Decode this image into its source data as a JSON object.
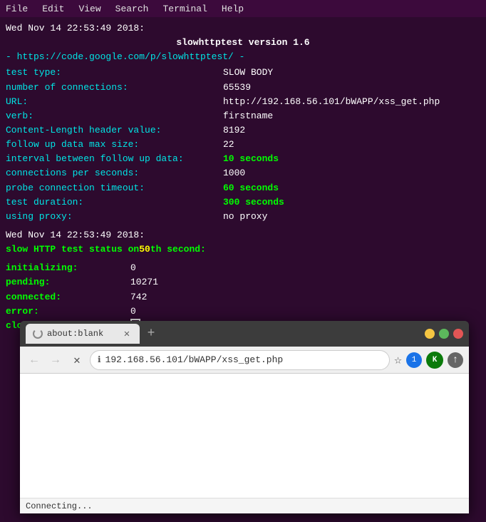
{
  "menubar": {
    "items": [
      "File",
      "Edit",
      "View",
      "Search",
      "Terminal",
      "Help"
    ]
  },
  "terminal": {
    "timestamp1": "Wed Nov 14 22:53:49 2018:",
    "title_line": "slowhttptest version 1.6",
    "url_line": "- https://code.google.com/p/slowhttptest/ -",
    "config": {
      "test_type_label": "test type:",
      "test_type_value": "SLOW BODY",
      "connections_label": "number of connections:",
      "connections_value": "65539",
      "url_label": "URL:",
      "url_value": "http://192.168.56.101/bWAPP/xss_get.php",
      "verb_label": "verb:",
      "verb_value": "firstname",
      "content_length_label": "Content-Length header value:",
      "content_length_value": "8192",
      "follow_up_label": "follow up data max size:",
      "follow_up_value": "22",
      "interval_label": "interval between follow up data:",
      "interval_value": "10 seconds",
      "conn_per_sec_label": "connections per seconds:",
      "conn_per_sec_value": "1000",
      "probe_timeout_label": "probe connection timeout:",
      "probe_timeout_value": "60 seconds",
      "test_duration_label": "test duration:",
      "test_duration_value": "300 seconds",
      "proxy_label": "using proxy:",
      "proxy_value": "no proxy"
    },
    "timestamp2": "Wed Nov 14 22:53:49 2018:",
    "status_line": "slow HTTP test status on ",
    "status_second": "50",
    "status_line_end": "th second:",
    "stats": {
      "initializing_label": "initializing:",
      "initializing_value": "0",
      "pending_label": "pending:",
      "pending_value": "10271",
      "connected_label": "connected:",
      "connected_value": "742",
      "error_label": "error:",
      "error_value": "0",
      "closed_label": "closed:",
      "closed_value": ""
    }
  },
  "browser": {
    "tab_title": "about:blank",
    "new_tab_label": "+",
    "back_label": "←",
    "forward_label": "→",
    "reload_label": "✕",
    "address_url": "192.168.56.101/bWAPP/xss_get.php",
    "address_full": "192.168.56.101/bWAPP/xss_get.php",
    "badge_number": "1",
    "ext1_label": "K",
    "ext2_label": "↑",
    "status_text": "Connecting..."
  }
}
